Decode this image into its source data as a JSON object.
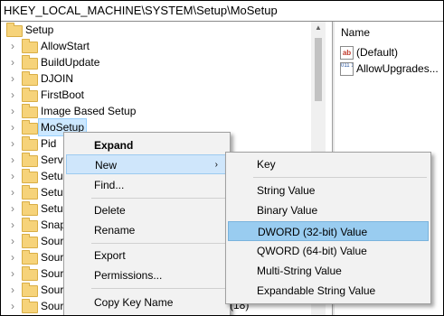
{
  "address_path": "HKEY_LOCAL_MACHINE\\SYSTEM\\Setup\\MoSetup",
  "tree": {
    "root": "Setup",
    "items": [
      {
        "label": "AllowStart"
      },
      {
        "label": "BuildUpdate"
      },
      {
        "label": "DJOIN"
      },
      {
        "label": "FirstBoot"
      },
      {
        "label": "Image Based Setup"
      },
      {
        "label": "MoSetup",
        "selected": true
      },
      {
        "label": "Pid"
      },
      {
        "label": "Servi"
      },
      {
        "label": "Setup"
      },
      {
        "label": "Setup"
      },
      {
        "label": "Setup"
      },
      {
        "label": "Snap"
      },
      {
        "label": "Sour"
      },
      {
        "label": "Sour"
      },
      {
        "label": "Sour"
      },
      {
        "label": "Sour"
      },
      {
        "label": "Sour"
      }
    ],
    "partial_suffix": "(18)"
  },
  "values_pane": {
    "column_name": "Name",
    "entries": [
      {
        "icon": "string-value-icon",
        "icon_text": "ab",
        "name": "(Default)"
      },
      {
        "icon": "binary-value-icon",
        "icon_text": "011 110",
        "name": "AllowUpgrades..."
      }
    ]
  },
  "context_menu": {
    "expand": "Expand",
    "new": "New",
    "find": "Find...",
    "delete": "Delete",
    "rename": "Rename",
    "export": "Export",
    "permissions": "Permissions...",
    "copy_key_name": "Copy Key Name",
    "submenu_arrow": "›"
  },
  "submenu": {
    "key": "Key",
    "string_value": "String Value",
    "binary_value": "Binary Value",
    "dword_value": "DWORD (32-bit) Value",
    "qword_value": "QWORD (64-bit) Value",
    "multi_string_value": "Multi-String Value",
    "expandable_string_value": "Expandable String Value"
  },
  "colors": {
    "hover": "#cfe6fb",
    "submenu_hover": "#99ccf0",
    "selection": "#cce8ff",
    "folder": "#f6d37a"
  }
}
